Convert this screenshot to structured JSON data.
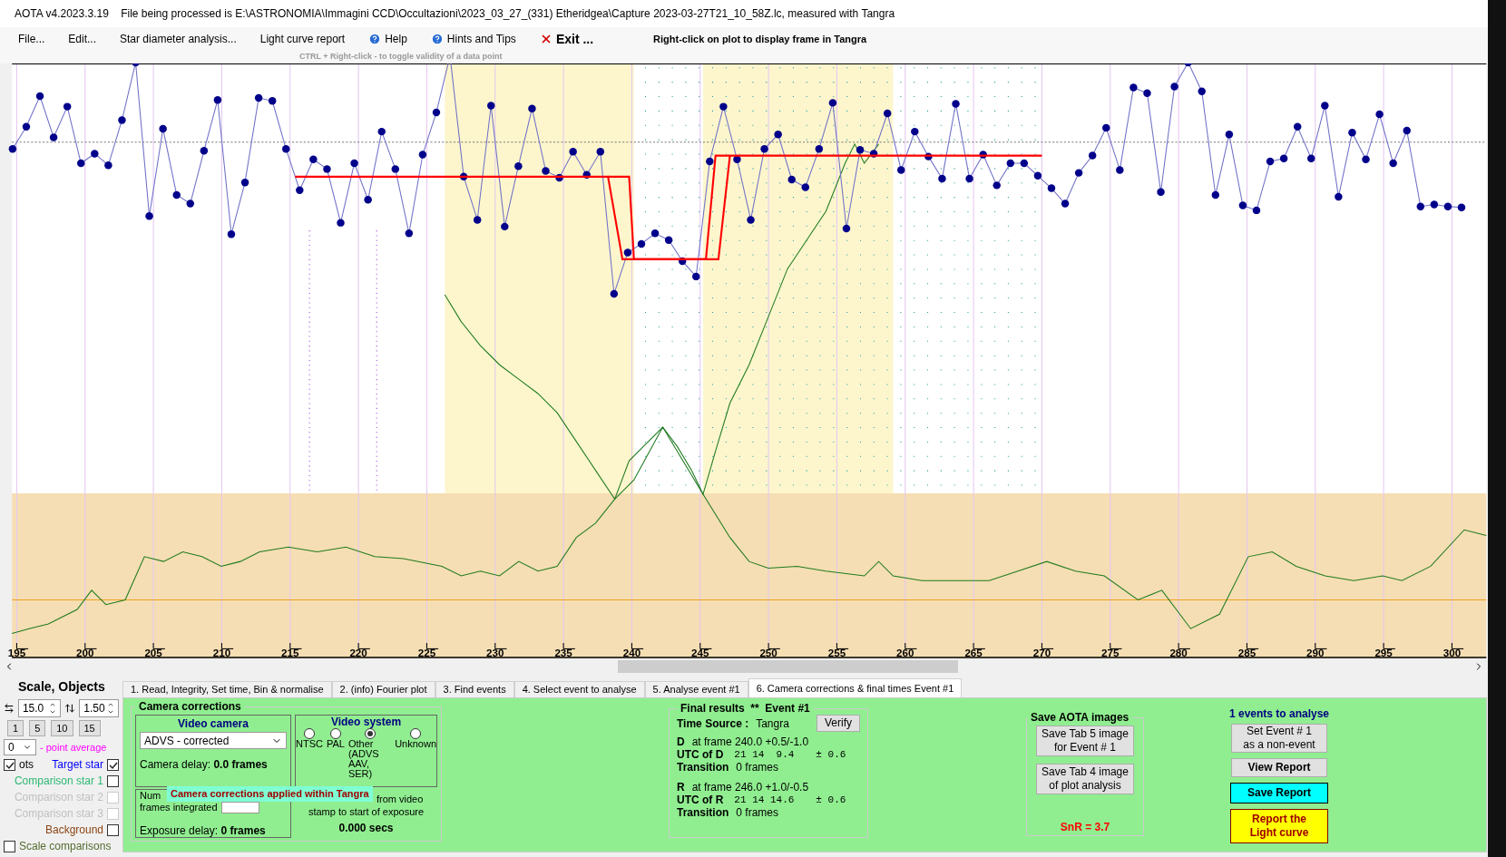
{
  "window": {
    "title": "AOTA v4.2023.3.19    File being processed is E:\\ASTRONOMIA\\Immagini CCD\\Occultazioni\\2023_03_27_(331) Etheridgea\\Capture 2023-03-27T21_10_58Z.lc, measured with Tangra"
  },
  "menu": [
    {
      "label": "File...",
      "kind": "plain"
    },
    {
      "label": "Edit...",
      "kind": "plain"
    },
    {
      "label": "Star diameter analysis...",
      "kind": "plain"
    },
    {
      "label": "Light curve report",
      "kind": "plain"
    },
    {
      "label": "Help",
      "kind": "help"
    },
    {
      "label": "Hints and Tips",
      "kind": "help"
    },
    {
      "label": "Exit ...",
      "kind": "exit"
    }
  ],
  "menu_note": "Right-click on plot to display frame in Tangra",
  "menu_hint": "CTRL + Right-click  -  to toggle validity of a data point",
  "plot": {
    "x_tick_labels": [
      "195",
      "200",
      "205",
      "210",
      "215",
      "220",
      "225",
      "230",
      "235",
      "240",
      "245",
      "250",
      "255",
      "260",
      "265",
      "270",
      "275",
      "280",
      "285",
      "290",
      "295",
      "300"
    ]
  },
  "scale_panel": {
    "title": "Scale,  Objects",
    "h_scale": "15.0",
    "v_scale": "1.50",
    "buttons": [
      "1",
      "5",
      "10",
      "15"
    ],
    "average_value": "0",
    "average_label": "- point average",
    "rows": [
      {
        "items": [
          {
            "kind": "left",
            "label": "ots",
            "checked": true,
            "disabled": false
          },
          {
            "kind": "right",
            "label": "Target star",
            "checked": true,
            "disabled": false,
            "color": "#0000ff"
          }
        ]
      },
      {
        "items": [
          {
            "kind": "right",
            "label": "Comparison star 1",
            "checked": false,
            "disabled": false,
            "color": "#2eb872"
          }
        ]
      },
      {
        "items": [
          {
            "kind": "right",
            "label": "Comparison star 2",
            "checked": false,
            "disabled": true,
            "color": "#c0c0c0"
          }
        ]
      },
      {
        "items": [
          {
            "kind": "right",
            "label": "Comparison star 3",
            "checked": false,
            "disabled": true,
            "color": "#c0c0c0"
          }
        ]
      },
      {
        "items": [
          {
            "kind": "right",
            "label": "Background",
            "checked": false,
            "disabled": false,
            "color": "#8b4513"
          }
        ]
      },
      {
        "items": [
          {
            "kind": "left",
            "label": "Scale comparisons",
            "checked": false,
            "disabled": false,
            "color": "#556b2f"
          }
        ]
      }
    ]
  },
  "tabs": [
    {
      "label": "1.  Read, Integrity, Set time, Bin & normalise",
      "selected": false
    },
    {
      "label": "2. (info)  Fourier plot",
      "selected": false
    },
    {
      "label": "3. Find events",
      "selected": false
    },
    {
      "label": "4. Select event to analyse",
      "selected": false
    },
    {
      "label": "5. Analyse event #1",
      "selected": false
    },
    {
      "label": "6. Camera corrections & final times Event #1",
      "selected": true
    }
  ],
  "camera_corrections": {
    "title": "Camera corrections",
    "video_camera": {
      "title": "Video camera",
      "value": "ADVS - corrected",
      "delay_label": "Camera delay:",
      "delay_value": "0.0 frames"
    },
    "video_system": {
      "title": "Video system",
      "options": [
        {
          "label": "NTSC",
          "selected": false
        },
        {
          "label": "PAL",
          "selected": false
        },
        {
          "label": "Other\n(ADVS\nAAV, SER)",
          "selected": true
        },
        {
          "label": "Unknown",
          "selected": false
        }
      ]
    },
    "frames_label_1": "Num",
    "frames_label_2": "frames integrated",
    "exposure_label": "Exposure delay:",
    "exposure_value": "0 frames",
    "offset_label_1": "from video",
    "offset_label_2": "stamp to start of exposure",
    "offset_value": "0.000 secs",
    "overlay": "Camera corrections applied within Tangra"
  },
  "final_results": {
    "title": "Final results  **  Event #1",
    "verify": "Verify",
    "time_source_label": "Time Source :",
    "time_source": "Tangra",
    "events": [
      {
        "letter": "D",
        "frame": "at frame 240.0  +0.5/-1.0",
        "utc_label": "UTC of D",
        "utc": "21 14  9.4",
        "error": "± 0.6",
        "transition_label": "Transition",
        "transition": "0 frames"
      },
      {
        "letter": "R",
        "frame": "at frame 246.0  +1.0/-0.5",
        "utc_label": "UTC of R",
        "utc": "21 14 14.6",
        "error": "± 0.6",
        "transition_label": "Transition",
        "transition": "0 frames"
      }
    ]
  },
  "save_images": {
    "title": "Save AOTA images",
    "buttons": [
      "Save Tab 5 image\nfor Event # 1",
      "Save Tab 4 image\nof plot analysis"
    ],
    "snr": "SnR = 3.7"
  },
  "events_panel": {
    "title": "1  events to analyse",
    "set_button": "Set Event # 1\nas a non-event",
    "view_button": "View Report",
    "save_button": "Save Report",
    "report_button": "Report the\nLight curve"
  }
}
